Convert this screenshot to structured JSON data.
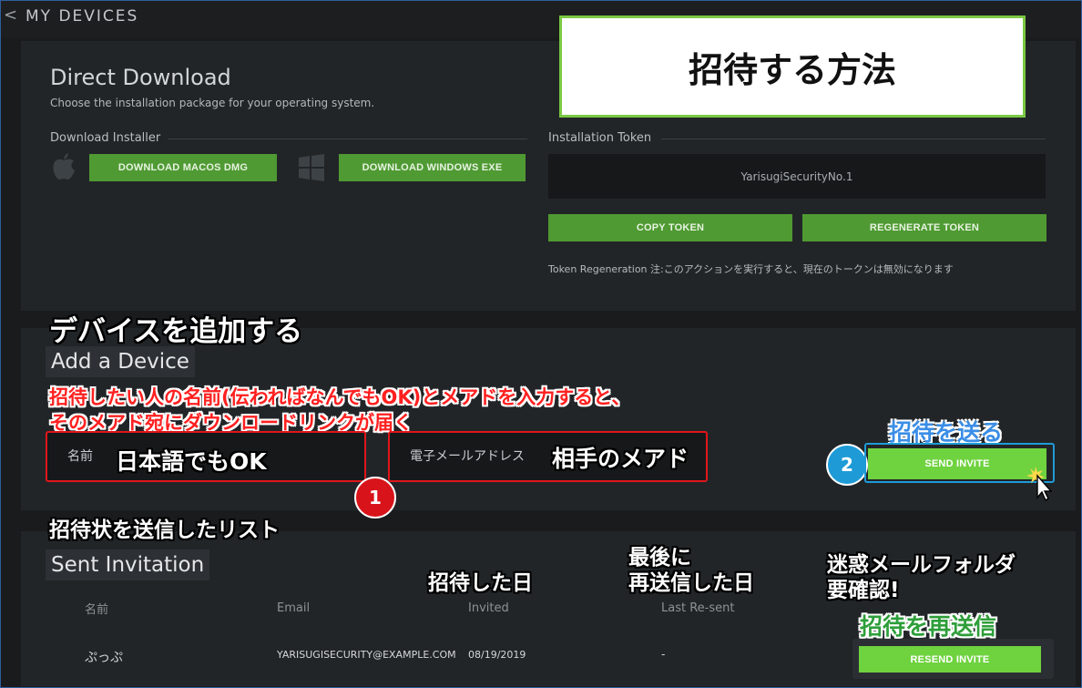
{
  "header": {
    "back_glyph": "<",
    "title": "MY DEVICES"
  },
  "overlay_title": "招待する方法",
  "direct_download": {
    "heading": "Direct Download",
    "subtitle": "Choose the installation package for your operating system.",
    "installer_label": "Download Installer",
    "macos_button": "DOWNLOAD MACOS DMG",
    "windows_button": "DOWNLOAD WINDOWS EXE"
  },
  "token": {
    "label": "Installation Token",
    "value": "YarisugiSecurityNo.1",
    "copy_button": "COPY TOKEN",
    "regenerate_button": "REGENERATE TOKEN",
    "note": "Token Regeneration 注:このアクションを実行すると、現在のトークンは無効になります"
  },
  "add_device": {
    "jp_heading": "デバイスを追加する",
    "heading": "Add a Device",
    "jp_instruction_line1": "招待したい人の名前(伝わればなんでもOK)とメアドを入力すると、",
    "jp_instruction_line2": "そのメアド宛にダウンロードリンクが届く",
    "name_label": "名前",
    "name_hint": "日本語でもOK",
    "email_label": "電子メールアドレス",
    "email_hint": "相手のメアド",
    "badge1": "1",
    "badge2": "2",
    "send_hint": "招待を送る",
    "send_button": "SEND INVITE"
  },
  "sent": {
    "jp_heading": "招待状を送信したリスト",
    "heading": "Sent Invitation",
    "invited_note": "招待した日",
    "resent_note_line1": "最後に",
    "resent_note_line2": "再送信した日",
    "spam_note_line1": "迷惑メールフォルダ",
    "spam_note_line2": "要確認!",
    "resend_hint": "招待を再送信",
    "columns": [
      "名前",
      "Email",
      "Invited",
      "Last Re-sent"
    ],
    "rows": [
      {
        "name": "ぷっぷ",
        "email": "YARISUGISECURITY@EXAMPLE.COM",
        "invited": "08/19/2019",
        "last_resent": "-",
        "action": "RESEND INVITE"
      }
    ]
  },
  "colors": {
    "accent_green": "#4f9a33",
    "bright_green": "#6fd23f",
    "red": "#e0161a",
    "blue": "#1e9bd7"
  },
  "icons": [
    "apple-icon",
    "windows-icon",
    "chevron-left-icon",
    "cursor-icon"
  ]
}
